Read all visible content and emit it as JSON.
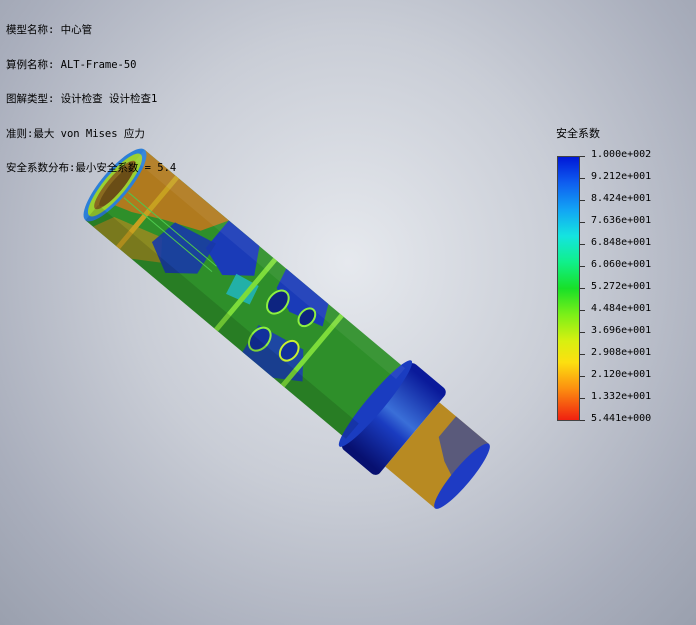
{
  "info": {
    "model_name": "模型名称: 中心管",
    "study_name": "算例名称: ALT-Frame-50",
    "plot_type": "图解类型: 设计检查 设计检查1",
    "criterion": "准则:最大 von Mises 应力",
    "fos_distribution": "安全系数分布:最小安全系数 = 5.4"
  },
  "legend": {
    "title": "安全系数",
    "labels": [
      "1.000e+002",
      "9.212e+001",
      "8.424e+001",
      "7.636e+001",
      "6.848e+001",
      "6.060e+001",
      "5.272e+001",
      "4.484e+001",
      "3.696e+001",
      "2.908e+001",
      "2.120e+001",
      "1.332e+001",
      "5.441e+000"
    ]
  },
  "colors": {
    "high": "#0018d8",
    "mid": "#18e028",
    "low": "#f02010"
  }
}
